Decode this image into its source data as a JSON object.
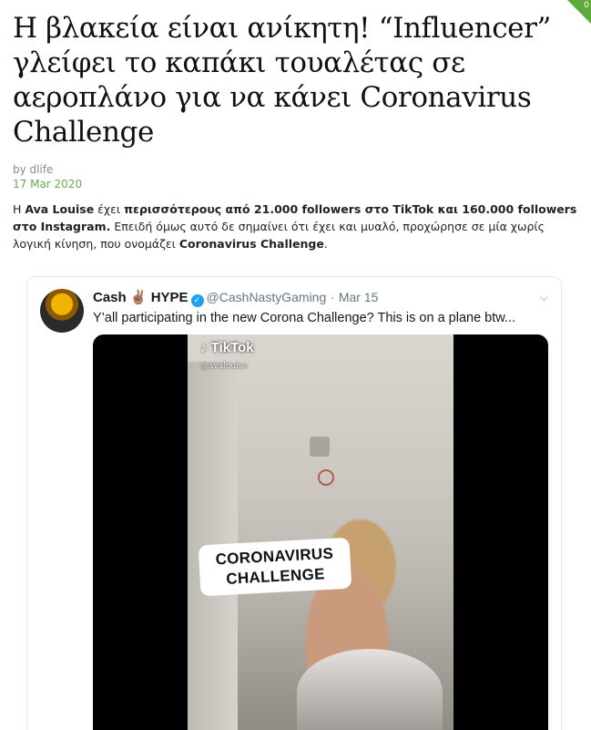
{
  "corner_badge": "0",
  "article": {
    "title": "Η βλακεία είναι ανίκητη! “Influencer” γλείφει το καπάκι τουαλέτας σε αεροπλάνο για να κάνει Coronavirus Challenge",
    "byline": "by dlife",
    "date": "17 Mar 2020",
    "intro": {
      "p1": "Η ",
      "b1": "Ava Louise",
      "p2": " έχει ",
      "b2": "περισσότερους από 21.000 followers στο TikTok και 160.000 followers στο Instagram.",
      "p3": " Επειδή όμως αυτό δε σημαίνει ότι έχει και μυαλό, προχώρησε σε μία χωρίς λογική κίνηση, που ονομάζει ",
      "b3": "Coronavirus Challenge",
      "p4": "."
    }
  },
  "tweet": {
    "name": "Cash ✌🏽 HYPE",
    "verified_icon": "✓",
    "handle": "@CashNastyGaming",
    "separator": "·",
    "date": "Mar 15",
    "text": "Y’all participating in the new Corona Challenge? This is on a plane btw...",
    "media": {
      "watermark": "TikTok",
      "watermark_icon": "♪",
      "username": "@avalouise",
      "caption_line1": "CORONAVIRUS",
      "caption_line2": "CHALLENGE"
    }
  },
  "icons": {
    "verified": "verified-badge-icon",
    "chevron": "chevron-down-icon",
    "tiktok": "tiktok-note-icon"
  },
  "colors": {
    "date_green": "#6aa84f",
    "twitter_blue": "#1da1f2",
    "badge_green": "#5fa83a"
  }
}
